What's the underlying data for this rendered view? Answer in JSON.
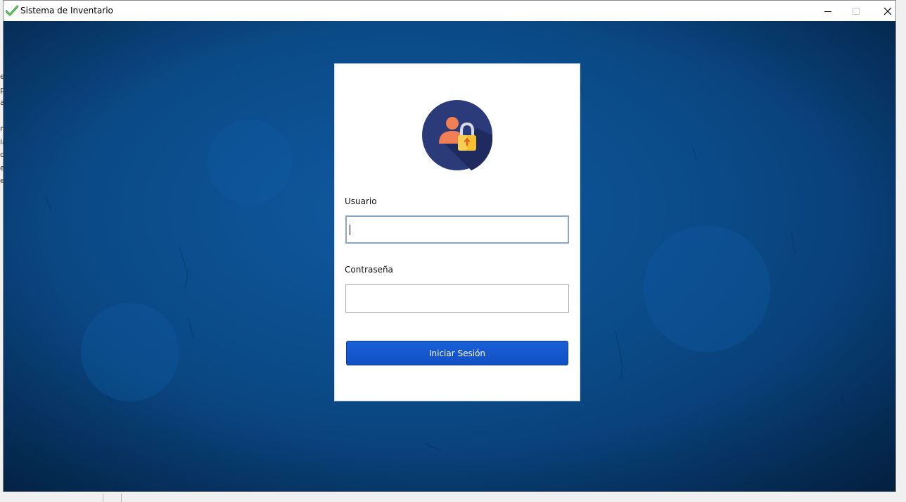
{
  "window": {
    "title": "Sistema de Inventario",
    "icon": "green-checkmark-icon",
    "controls": {
      "minimize": "minimize-icon",
      "maximize": "maximize-icon",
      "close": "close-icon"
    }
  },
  "login": {
    "avatar_icon": "user-lock-icon",
    "username_label": "Usuario",
    "username_value": "",
    "password_label": "Contraseña",
    "password_value": "",
    "submit_label": "Iniciar Sesión"
  },
  "background_fragments": [
    "e",
    "pa",
    "a",
    "",
    "nt",
    "ia",
    "o",
    "et",
    "eb"
  ],
  "colors": {
    "background": "#0b4a88",
    "button": "#1655cc",
    "avatar_circle": "#2b3a78",
    "avatar_person": "#f07f55",
    "avatar_lock": "#f5c132"
  }
}
